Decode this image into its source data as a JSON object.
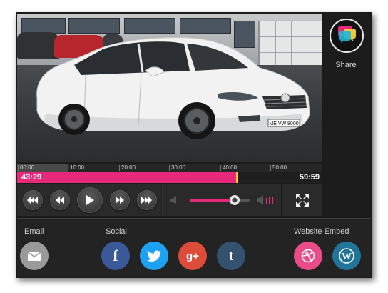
{
  "player": {
    "time_current": "43:29",
    "time_total": "59:59",
    "progress": 0.72,
    "timeline_ticks": [
      "00:00",
      "10:00",
      "20:00",
      "30:00",
      "40:00",
      "50:00"
    ],
    "volume": 0.75,
    "accent_color": "#e6297b",
    "controls": [
      "skip-back-icon",
      "rewind-icon",
      "play-icon",
      "fast-forward-icon",
      "skip-forward-icon",
      "volume-low-icon",
      "volume-high-icon",
      "fullscreen-icon"
    ],
    "video_plate_text": "ME VW 8000"
  },
  "share_panel": {
    "label": "Share",
    "icon": "chat-bubbles-icon"
  },
  "bottom": {
    "email_label": "Email",
    "social_label": "Social",
    "embed_label": "Website Embed",
    "buttons": [
      {
        "name": "email",
        "glyph": "",
        "color": "#9a9a9a"
      },
      {
        "name": "facebook",
        "glyph": "f",
        "color": "#3b5998"
      },
      {
        "name": "twitter",
        "glyph": "",
        "color": "#1da1f2"
      },
      {
        "name": "google-plus",
        "glyph": "g+",
        "color": "#dd4b39"
      },
      {
        "name": "tumblr",
        "glyph": "t",
        "color": "#34526f"
      },
      {
        "name": "dribbble",
        "glyph": "",
        "color": "#ea4c89"
      },
      {
        "name": "wordpress",
        "glyph": "W",
        "color": "#21759b"
      }
    ]
  }
}
